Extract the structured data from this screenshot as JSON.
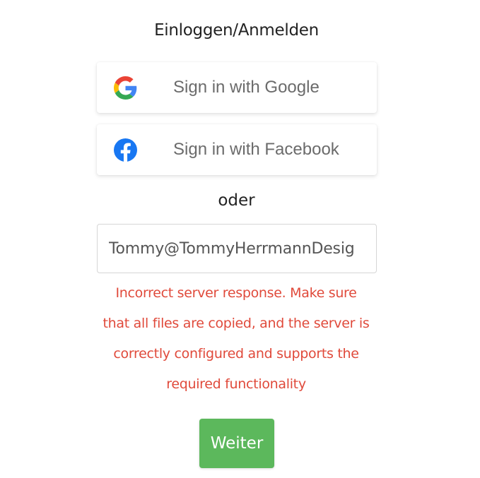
{
  "heading": "Einloggen/Anmelden",
  "social": {
    "google": {
      "label": "Sign in with Google",
      "icon": "google-icon"
    },
    "facebook": {
      "label": "Sign in with Facebook",
      "icon": "facebook-icon",
      "color": "#1877f2"
    }
  },
  "separator": "oder",
  "email": {
    "value": "Tommy@TommyHerrmannDesig",
    "placeholder": ""
  },
  "error": {
    "lines": [
      "Incorrect server response.  Make sure",
      "that all files are copied, and the server is",
      "correctly configured and supports the",
      "required functionality"
    ],
    "color": "#e04a3b"
  },
  "submit": {
    "label": "Weiter",
    "color": "#5cb85c"
  }
}
